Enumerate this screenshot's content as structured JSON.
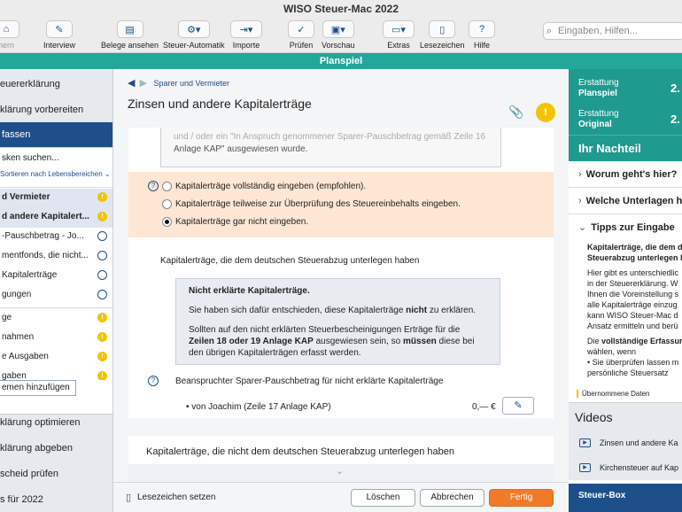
{
  "window": {
    "title": "WISO Steuer-Mac 2022"
  },
  "toolbar": {
    "items": [
      {
        "label": "hern",
        "icon": "home-icon"
      },
      {
        "label": "Interview",
        "icon": "pencil-icon"
      },
      {
        "label": "Belege ansehen",
        "icon": "receipt-icon"
      },
      {
        "label": "Steuer-Automatik",
        "icon": "gear-icon"
      },
      {
        "label": "Importe",
        "icon": "import-icon"
      },
      {
        "label": "Prüfen",
        "icon": "check-document-icon"
      },
      {
        "label": "Vorschau",
        "icon": "preview-icon"
      },
      {
        "label": "Extras",
        "icon": "car-icon"
      },
      {
        "label": "Lesezeichen",
        "icon": "bookmark-icon"
      },
      {
        "label": "Hilfe",
        "icon": "help-icon"
      }
    ],
    "search_placeholder": "Eingaben, Hilfen..."
  },
  "mode_bar": {
    "label": "Planspiel"
  },
  "sidebar": {
    "top_items": [
      "euererklärung",
      "klärung vorbereiten"
    ],
    "active": "fassen",
    "search": "sken suchen...",
    "sort": "Sortieren nach Lebensbereichen",
    "sub_items": [
      {
        "label": "d Vermieter",
        "marker": "warn",
        "selected": true
      },
      {
        "label": "d andere Kapitalert...",
        "marker": "warn",
        "selected": true
      },
      {
        "label": "-Pauschbetrag - Jo...",
        "marker": "open",
        "selected": false
      },
      {
        "label": "mentfonds, die nicht...",
        "marker": "open",
        "selected": false
      },
      {
        "label": "Kapitalerträge",
        "marker": "open",
        "selected": false
      },
      {
        "label": "gungen",
        "marker": "open",
        "selected": false
      },
      {
        "label": "ge",
        "marker": "warn",
        "selected": false
      },
      {
        "label": "nahmen",
        "marker": "warn",
        "selected": false
      },
      {
        "label": "e Ausgaben",
        "marker": "warn",
        "selected": false
      },
      {
        "label": "gaben",
        "marker": "warn",
        "selected": false
      }
    ],
    "add_button": "emen hinzufügen",
    "bottom_items": [
      "klärung optimieren",
      "klärung abgeben",
      "scheid prüfen",
      "s für 2022"
    ]
  },
  "main": {
    "breadcrumb": "Sparer und Vermieter",
    "title": "Zinsen und andere Kapitalerträge",
    "faded_text_1": "und / oder ein \"In Anspruch genommener Sparer-Pauschbetrag gemäß Zeile 16",
    "faded_text_2": "Anlage KAP\" ausgewiesen wurde.",
    "options": [
      {
        "label": "Kapitalerträge vollständig eingeben (empfohlen).",
        "selected": false
      },
      {
        "label": "Kapitalerträge teilweise zur Überprüfung des Steuereinbehalts eingeben.",
        "selected": false
      },
      {
        "label": "Kapitalerträge gar nicht eingeben.",
        "selected": true
      }
    ],
    "section_heading": "Kapitalerträge, die dem deutschen Steuerabzug unterlegen haben",
    "info": {
      "title": "Nicht erklärte Kapitalerträge.",
      "p1_a": "Sie haben sich dafür entschieden, diese Kapitalerträge ",
      "p1_b": "nicht",
      "p1_c": " zu erklären.",
      "p2_a": "Sollten auf den nicht erklärten Steuerbescheinigungen Erträge für die ",
      "p2_b": "Zeilen 18 oder 19 Anlage KAP",
      "p2_c": " ausgewiesen sein, so ",
      "p2_d": "müssen",
      "p2_e": " diese bei den übrigen Kapitalerträgen erfasst werden."
    },
    "pausch_label": "Beanspruchter Sparer-Pauschbetrag für nicht erklärte Kapitalerträge",
    "joachim_label": "• von Joachim (Zeile 17 Anlage KAP)",
    "amount": "0,— €",
    "section2_heading": "Kapitalerträge, die nicht dem deutschen Steuerabzug unterlegen haben",
    "bookmark_label": "Lesezeichen setzen",
    "buttons": {
      "delete": "Löschen",
      "cancel": "Abbrechen",
      "done": "Fertig"
    }
  },
  "right": {
    "erst1_a": "Erstattung",
    "erst1_b": "Planspiel",
    "erst1_val": "2.",
    "erst2_a": "Erstattung",
    "erst2_b": "Original",
    "erst2_val": "2.",
    "nachteil": "Ihr Nachteil",
    "acc1": "Worum geht's hier?",
    "acc2": "Welche Unterlagen he",
    "acc3": "Tipps zur Eingabe",
    "tips_b1": "Kapitalerträge, die dem d",
    "tips_b2": "Steuerabzug unterlegen l",
    "tips_lines": [
      "Hier gibt es unterschiedlic",
      "in der Steuererklärung. W",
      "Ihnen die Voreinstellung s",
      "alle Kapitalerträge einzug",
      "kann WISO Steuer-Mac d",
      "Ansatz ermitteln und berü"
    ],
    "tips_b3a": "Die ",
    "tips_b3b": "vollständige Erfassur",
    "tips_line_w": "wählen, wenn",
    "tips_bul1": "• Sie überprüfen lassen m",
    "tips_bul2": "  persönliche Steuersatz",
    "uebernommen": "Übernommene Daten",
    "videos": "Videos",
    "video1": "Zinsen und andere Ka",
    "video2": "Kirchensteuer auf Kap",
    "steuerbox": "Steuer-Box"
  }
}
